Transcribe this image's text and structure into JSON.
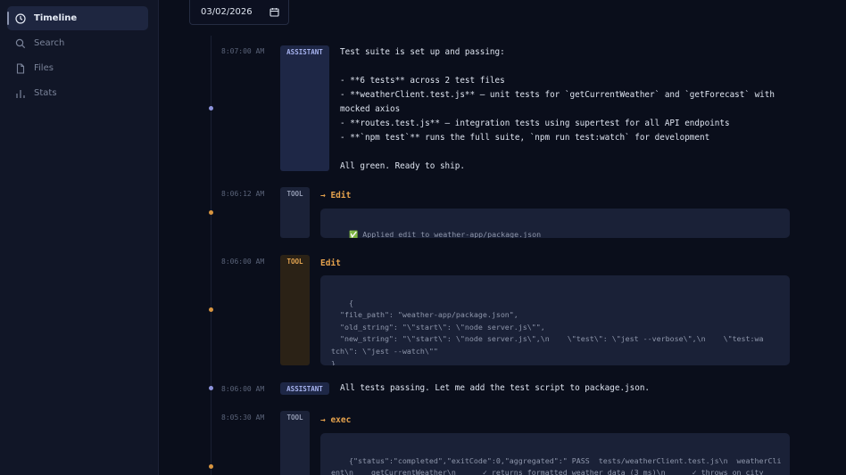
{
  "sidebar": {
    "items": [
      {
        "label": "Timeline",
        "icon": "clock-icon"
      },
      {
        "label": "Search",
        "icon": "search-icon"
      },
      {
        "label": "Files",
        "icon": "file-icon"
      },
      {
        "label": "Stats",
        "icon": "bar-chart-icon"
      }
    ]
  },
  "date_filter": {
    "value": "03/02/2026"
  },
  "colors": {
    "assistant": "#8d93dc",
    "tool": "#d89540",
    "background": "#0a0e1b"
  },
  "events": [
    {
      "time": "8:07:00 AM",
      "role": "ASSISTANT",
      "text": "Test suite is set up and passing:\n\n- **6 tests** across 2 test files\n- **weatherClient.test.js** — unit tests for `getCurrentWeather` and `getForecast` with\nmocked axios\n- **routes.test.js** — integration tests using supertest for all API endpoints\n- **`npm test`** runs the full suite, `npm run test:watch` for development\n\nAll green. Ready to ship."
    },
    {
      "time": "8:06:12 AM",
      "role": "TOOL",
      "tool_name": "→ Edit",
      "output": "✅ Applied edit to weather-app/package.json"
    },
    {
      "time": "8:06:00 AM",
      "role": "TOOL",
      "tool_name": "Edit",
      "output": "{\n  \"file_path\": \"weather-app/package.json\",\n  \"old_string\": \"\\\"start\\\": \\\"node server.js\\\"\",\n  \"new_string\": \"\\\"start\\\": \\\"node server.js\\\",\\n    \\\"test\\\": \\\"jest --verbose\\\",\\n    \\\"test:wa\ntch\\\": \\\"jest --watch\\\"\"\n}"
    },
    {
      "time": "8:06:00 AM",
      "role": "ASSISTANT",
      "text": "All tests passing. Let me add the test script to package.json."
    },
    {
      "time": "8:05:30 AM",
      "role": "TOOL",
      "tool_name": "→ exec",
      "output": "{\"status\":\"completed\",\"exitCode\":0,\"aggregated\":\" PASS  tests/weatherClient.test.js\\n  weatherCli\nent\\n    getCurrentWeather\\n      ✓ returns formatted weather data (3 ms)\\n      ✓ throws on city\nnot found (1 ms)\\n    getForecast\\n      ✓ returns 5 days of forecast data (2 ms)\\n PASS  test"
    }
  ]
}
